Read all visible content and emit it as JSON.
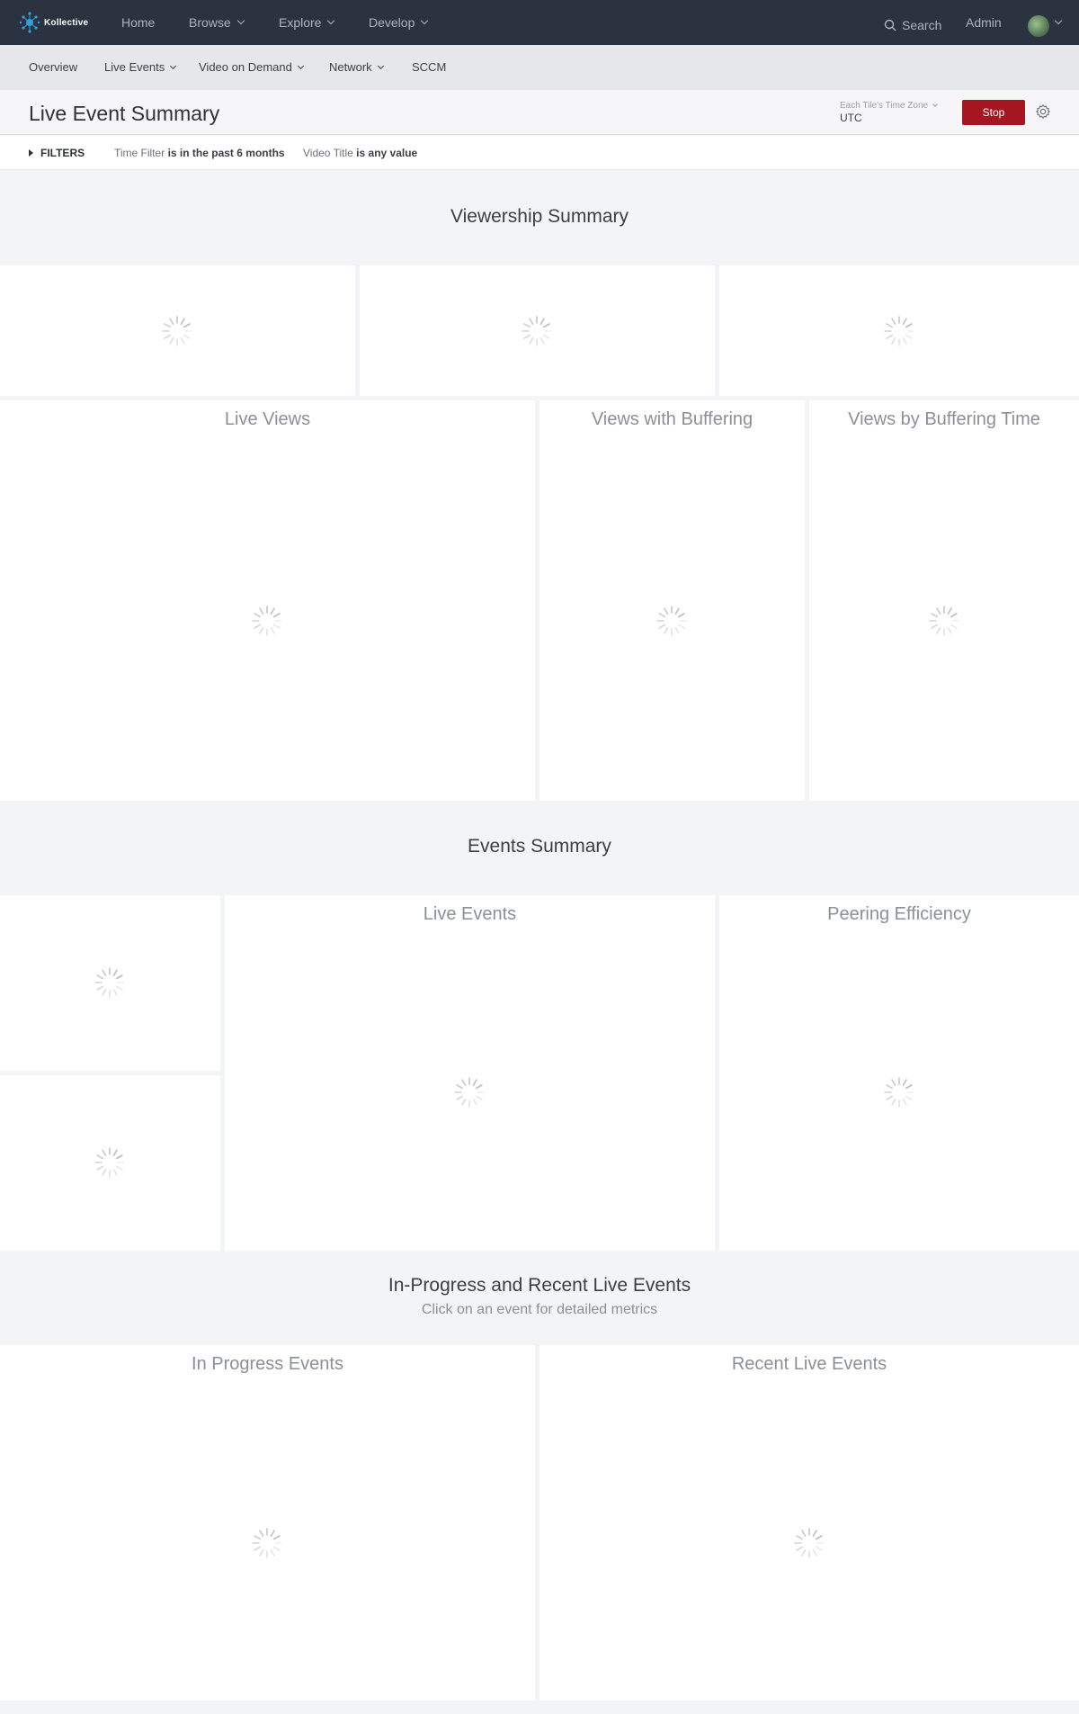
{
  "brand": {
    "name": "Kollective",
    "accent": "#2f9fe0"
  },
  "topnav": {
    "items": [
      {
        "label": "Home",
        "has_menu": false
      },
      {
        "label": "Browse",
        "has_menu": true
      },
      {
        "label": "Explore",
        "has_menu": true
      },
      {
        "label": "Develop",
        "has_menu": true
      }
    ],
    "search_label": "Search",
    "admin_label": "Admin",
    "search_icon": "search-icon",
    "user_icon": "avatar"
  },
  "subnav": {
    "items": [
      {
        "label": "Overview",
        "has_menu": false
      },
      {
        "label": "Live Events",
        "has_menu": true
      },
      {
        "label": "Video on Demand",
        "has_menu": true
      },
      {
        "label": "Network",
        "has_menu": true
      },
      {
        "label": "SCCM",
        "has_menu": false
      }
    ]
  },
  "header": {
    "title": "Live Event Summary",
    "timezone_label": "Each Tile's Time Zone",
    "timezone_value": "UTC",
    "stop_label": "Stop",
    "stop_color": "#a51620",
    "settings_icon": "gear-icon"
  },
  "filters": {
    "toggle_label": "FILTERS",
    "items": [
      {
        "field": "Time Filter",
        "condition": "is in the past 6 months"
      },
      {
        "field": "Video Title",
        "condition": "is any value"
      }
    ]
  },
  "sections": {
    "viewership": {
      "title": "Viewership Summary"
    },
    "events": {
      "title": "Events Summary"
    },
    "recent": {
      "title": "In-Progress and Recent Live Events",
      "subtitle": "Click on an event for detailed metrics"
    }
  },
  "tiles": {
    "live_views": "Live Views",
    "views_with_buffering": "Views with Buffering",
    "views_by_buffering_time": "Views by Buffering Time",
    "live_events": "Live Events",
    "peering_efficiency": "Peering Efficiency",
    "in_progress_events": "In Progress Events",
    "recent_live_events": "Recent Live Events"
  },
  "loading_icon": "spinner-icon"
}
